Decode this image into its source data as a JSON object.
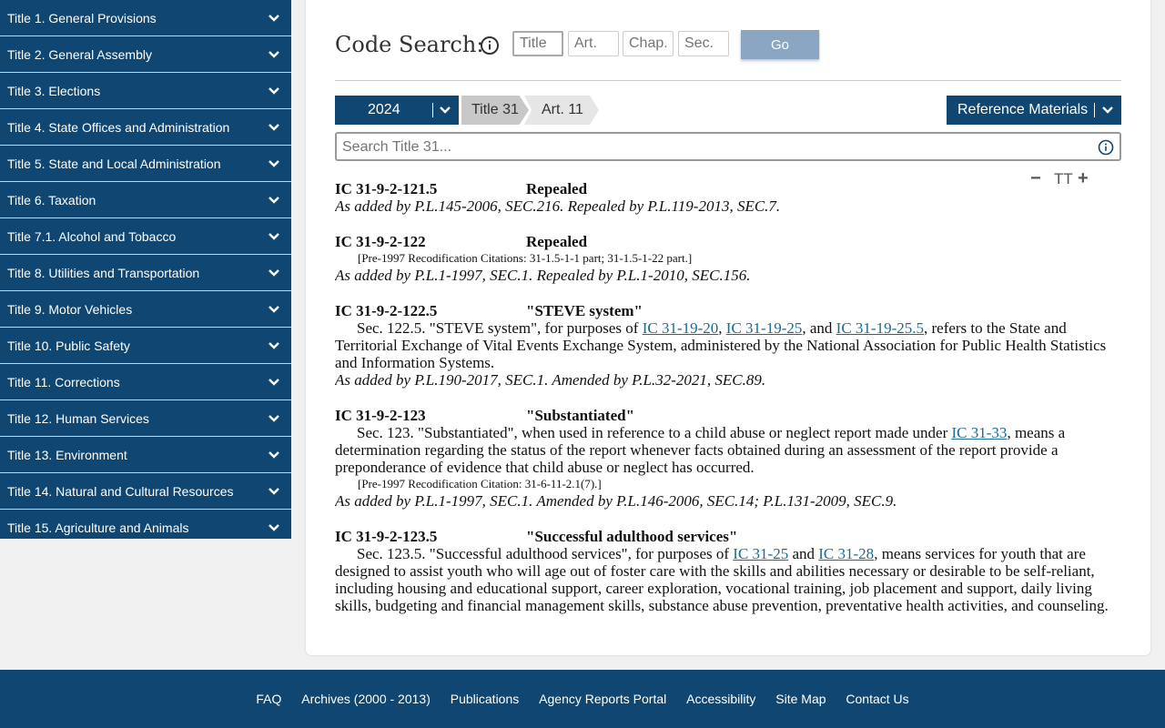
{
  "sidebar": {
    "items": [
      {
        "label": "Title 1. General Provisions"
      },
      {
        "label": "Title 2. General Assembly"
      },
      {
        "label": "Title 3. Elections"
      },
      {
        "label": "Title 4. State Offices and Administration"
      },
      {
        "label": "Title 5. State and Local Administration"
      },
      {
        "label": "Title 6. Taxation"
      },
      {
        "label": "Title 7.1. Alcohol and Tobacco"
      },
      {
        "label": "Title 8. Utilities and Transportation"
      },
      {
        "label": "Title 9. Motor Vehicles"
      },
      {
        "label": "Title 10. Public Safety"
      },
      {
        "label": "Title 11. Corrections"
      },
      {
        "label": "Title 12. Human Services"
      },
      {
        "label": "Title 13. Environment"
      },
      {
        "label": "Title 14. Natural and Cultural Resources"
      },
      {
        "label": "Title 15. Agriculture and Animals"
      }
    ]
  },
  "code_search": {
    "title": "Code Search:",
    "title_placeholder": "Title",
    "art_placeholder": "Art.",
    "chap_placeholder": "Chap.",
    "sec_placeholder": "Sec.",
    "go_label": "Go"
  },
  "toolbar": {
    "year": "2024",
    "crumb_title": "Title 31",
    "crumb_art": "Art. 11",
    "reference_label": "Reference Materials",
    "search_placeholder": "Search Title 31..."
  },
  "font_controls": {
    "minus": "−",
    "size": "TT",
    "plus": "+"
  },
  "sections": {
    "s1": {
      "num": "IC 31-9-2-121.5",
      "name": "Repealed",
      "history": "As added by P.L.145-2006, SEC.216. Repealed by P.L.119-2013, SEC.7."
    },
    "s2": {
      "num": "IC 31-9-2-122",
      "name": "Repealed",
      "recod": "[Pre-1997 Recodification Citations: 31-1.5-1-1 part; 31-1.5-1-22 part.]",
      "history": "As added by P.L.1-1997, SEC.1. Repealed by P.L.1-2010, SEC.156."
    },
    "s3": {
      "num": "IC 31-9-2-122.5",
      "name": "\"STEVE system\"",
      "t1": "Sec. 122.5. \"STEVE system\", for purposes of ",
      "l1": "IC 31-19-20",
      "t2": ", ",
      "l2": "IC 31-19-25",
      "t3": ", and ",
      "l3": "IC 31-19-25.5",
      "t4": ", refers to the State and Territorial Exchange of Vital Events Exchange System, administered by the National Association for Public Health Statistics and Information Systems.",
      "history": "As added by P.L.190-2017, SEC.1. Amended by P.L.32-2021, SEC.89."
    },
    "s4": {
      "num": "IC 31-9-2-123",
      "name": "\"Substantiated\"",
      "t1": "Sec. 123. \"Substantiated\", when used in reference to a child abuse or neglect report made under ",
      "l1": "IC 31-33",
      "t2": ", means a determination regarding the status of the report whenever facts obtained during an assessment of the report provide a preponderance of evidence that child abuse or neglect has occurred.",
      "recod": "[Pre-1997 Recodification Citation: 31-6-11-2.1(7).]",
      "history": "As added by P.L.1-1997, SEC.1. Amended by P.L.146-2006, SEC.14; P.L.131-2009, SEC.9."
    },
    "s5": {
      "num": "IC 31-9-2-123.5",
      "name": "\"Successful adulthood services\"",
      "t1": "Sec. 123.5. \"Successful adulthood services\", for purposes of ",
      "l1": "IC 31-25",
      "t2": " and ",
      "l2": "IC 31-28",
      "t3": ", means services for youth that are designed to assist youth who will age out of foster care with the skills and abilities necessary or desirable to be self-reliant, including housing and educational support, career exploration, vocational training, job placement and support, daily living skills, budgeting and financial management skills, substance abuse prevention, preventative health activities, and counseling."
    }
  },
  "footer": {
    "links": [
      "FAQ",
      "Archives (2000 - 2013)",
      "Publications",
      "Agency Reports Portal",
      "Accessibility",
      "Site Map",
      "Contact Us"
    ]
  },
  "colors": {
    "navy": "#0f4672",
    "go_button": "#8aa6c2",
    "link": "#1a6b8f"
  }
}
